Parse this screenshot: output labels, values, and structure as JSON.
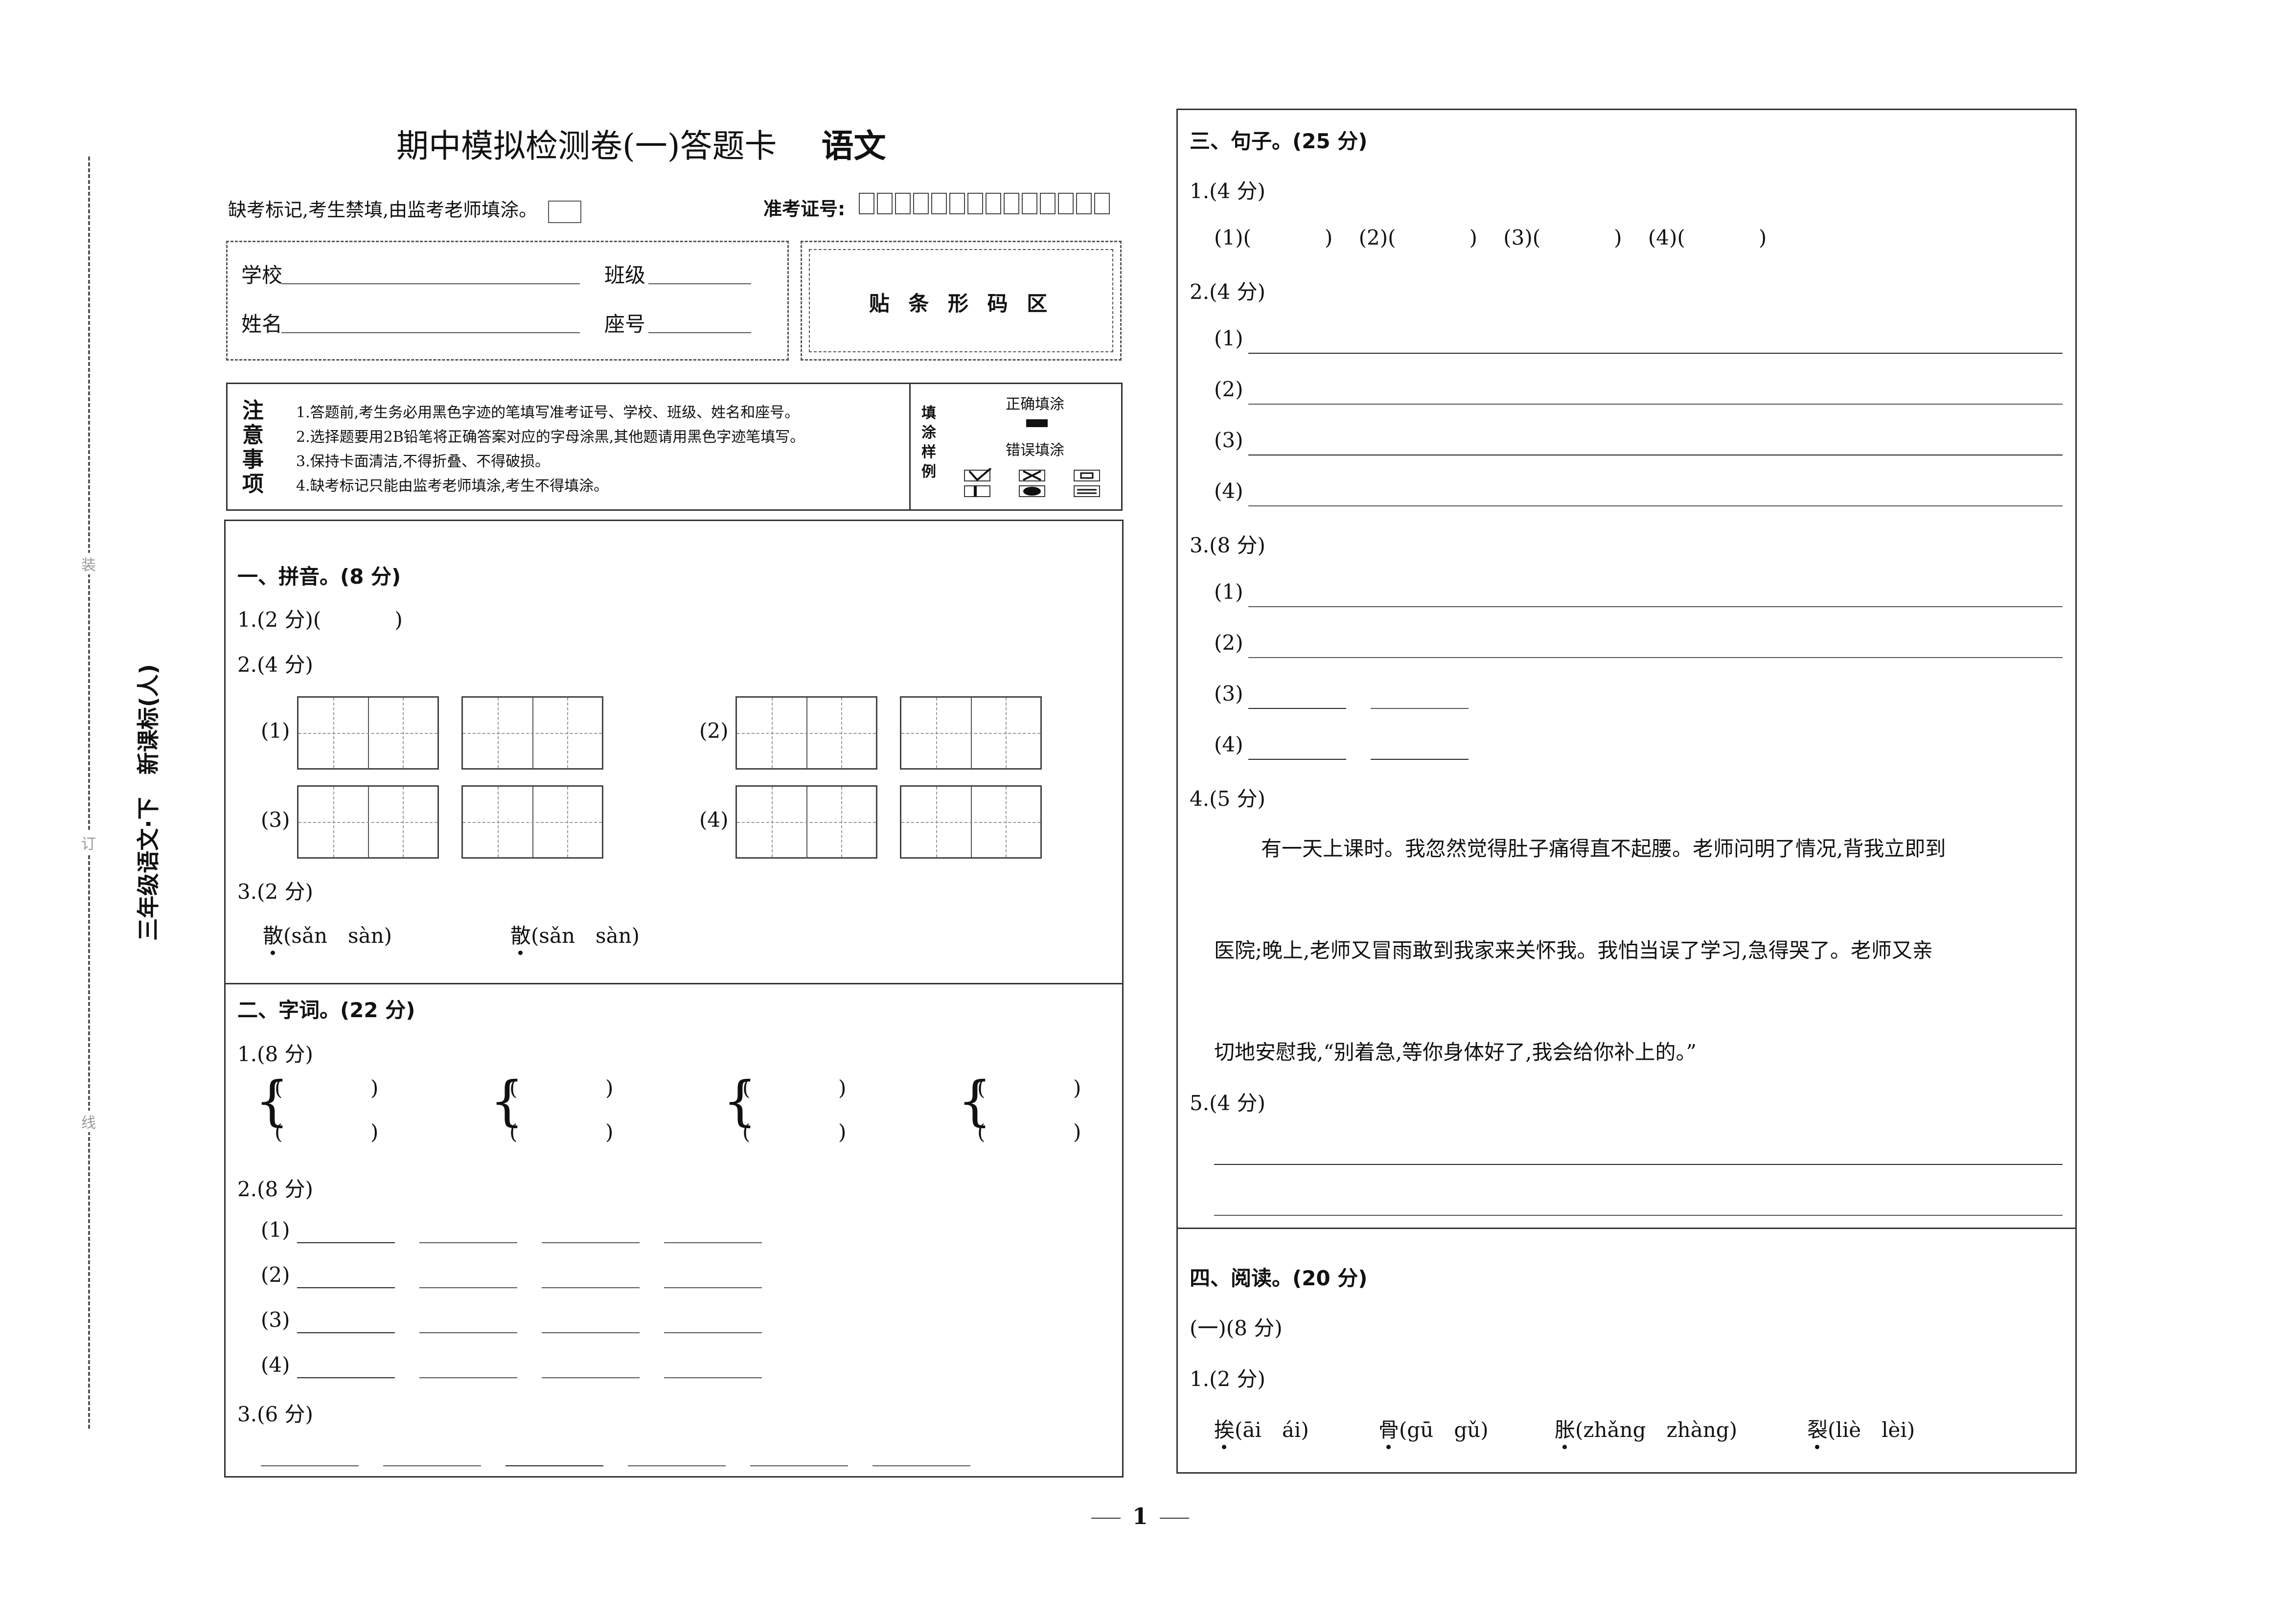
{
  "header": {
    "title": "期中模拟检测卷(一)答题卡",
    "subject": "语文",
    "absent_note": "缺考标记,考生禁填,由监考老师填涂。",
    "exam_no_label": "准考证号:",
    "school_label": "学校",
    "class_label": "班级",
    "name_label": "姓名",
    "seat_label": "座号",
    "barcode_label": "贴 条 形 码 区"
  },
  "notice": {
    "title_chars": [
      "注",
      "意",
      "事",
      "项"
    ],
    "items": [
      "1.答题前,考生务必用黑色字迹的笔填写准考证号、学校、班级、姓名和座号。",
      "2.选择题要用2B铅笔将正确答案对应的字母涂黑,其他题请用黑色字迹笔填写。",
      "3.保持卡面清洁,不得折叠、不得破损。",
      "4.缺考标记只能由监考老师填涂,考生不得填涂。"
    ],
    "sample_chars": [
      "填",
      "涂",
      "样",
      "例"
    ],
    "correct_label": "正确填涂",
    "wrong_label": "错误填涂"
  },
  "side": {
    "text": "三年级语文·下　新课标(人)",
    "binding_marks": [
      "装",
      "订",
      "线"
    ]
  },
  "sec1": {
    "title": "一、拼音。(8 分)",
    "q1": "1.(2 分)(",
    "q1_close": ")",
    "q2": "2.(4 分)",
    "q2_labels": [
      "(1)",
      "(2)",
      "(3)",
      "(4)"
    ],
    "q3": "3.(2 分)",
    "q3_items": [
      "散(sǎn　sàn)",
      "散(sǎn　sàn)"
    ]
  },
  "sec2": {
    "title": "二、字词。(22 分)",
    "q1": "1.(8 分)",
    "paren_open": "(",
    "paren_close": ")",
    "q2": "2.(8 分)",
    "q2_labels": [
      "(1)",
      "(2)",
      "(3)",
      "(4)"
    ],
    "q3": "3.(6 分)"
  },
  "sec3": {
    "title": "三、句子。(25 分)",
    "q1": "1.(4 分)",
    "q1_items": [
      "(1)(",
      "(2)(",
      "(3)(",
      "(4)("
    ],
    "q1_close": ")",
    "q2": "2.(4 分)",
    "q2_labels": [
      "(1)",
      "(2)",
      "(3)",
      "(4)"
    ],
    "q3": "3.(8 分)",
    "q3_labels": [
      "(1)",
      "(2)",
      "(3)",
      "(4)"
    ],
    "q4": "4.(5 分)",
    "q4_lines": [
      "有一天上课时。我忽然觉得肚子痛得直不起腰。老师问明了情况,背我立即到",
      "医院;晚上,老师又冒雨敢到我家来关怀我。我怕当误了学习,急得哭了。老师又亲",
      "切地安慰我,“别着急,等你身体好了,我会给你补上的。”"
    ],
    "q5": "5.(4 分)"
  },
  "sec4": {
    "title": "四、阅读。(20 分)",
    "part1": "(一)(8 分)",
    "q1": "1.(2 分)",
    "q1_items": [
      "挨(āi　ái)",
      "骨(gū　gǔ)",
      "胀(zhǎng　zhàng)",
      "裂(liè　lèi)"
    ]
  },
  "footer": {
    "page_number": "1"
  }
}
